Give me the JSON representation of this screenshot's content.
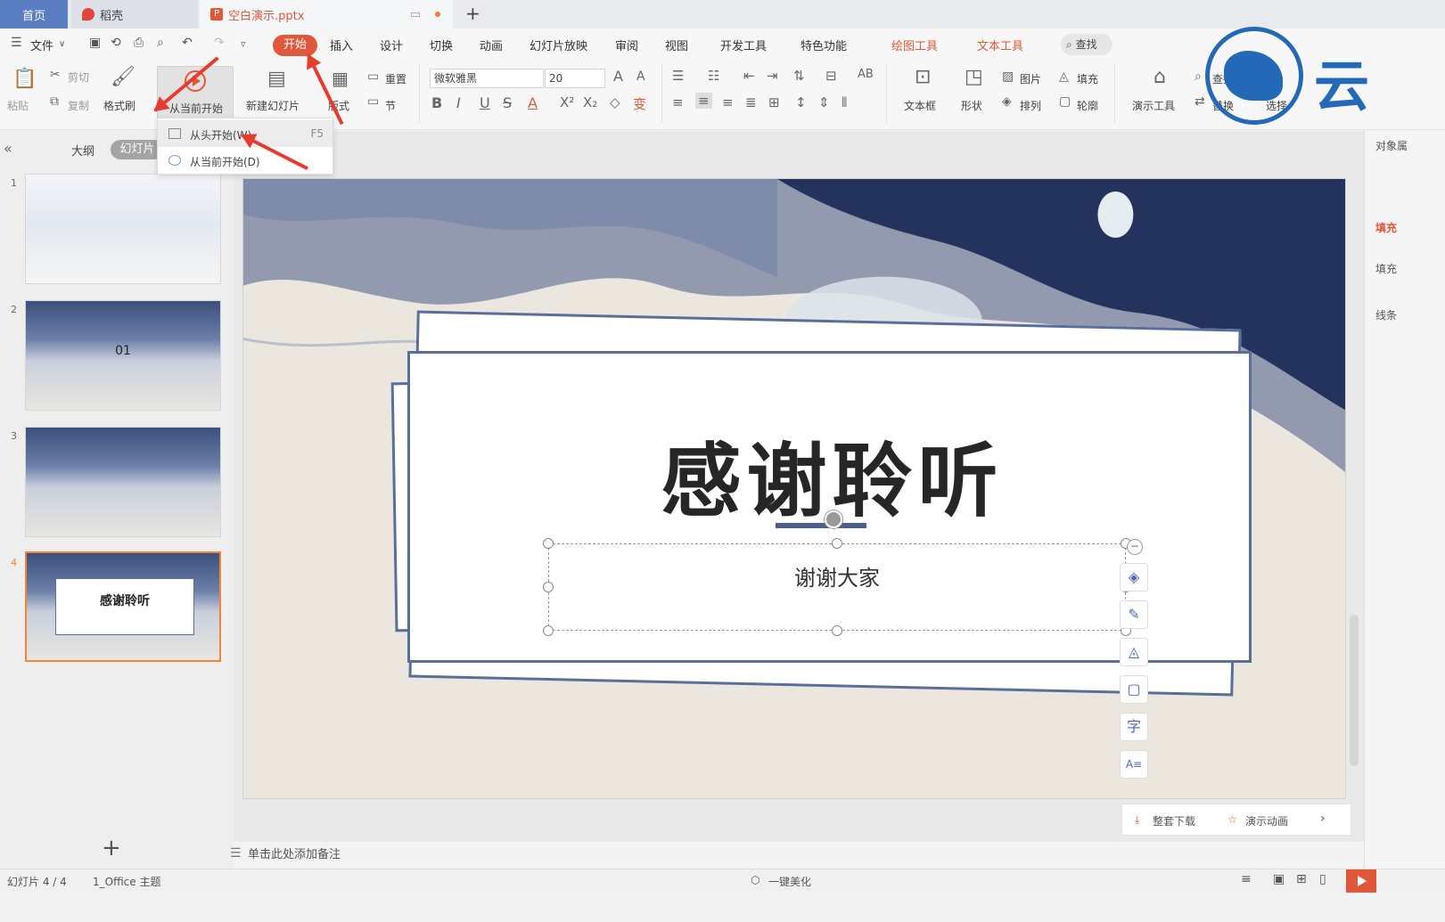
{
  "tabs": {
    "home": "首页",
    "docer": "稻壳",
    "file": "空白演示.pptx",
    "new_tab": "+"
  },
  "menu": {
    "file": "文件",
    "items": [
      "开始",
      "插入",
      "设计",
      "切换",
      "动画",
      "幻灯片放映",
      "审阅",
      "视图",
      "开发工具",
      "特色功能"
    ],
    "context_items": [
      "绘图工具",
      "文本工具"
    ],
    "search": "查找"
  },
  "ribbon": {
    "paste": "粘贴",
    "cut": "剪切",
    "copy": "复制",
    "format_painter": "格式刷",
    "start_from_current": "从当前开始",
    "new_slide": "新建幻灯片",
    "layout": "版式",
    "reset": "重置",
    "section": "节",
    "font_name": "微软雅黑",
    "font_size": "20",
    "textbox": "文本框",
    "shape": "形状",
    "picture": "图片",
    "fill": "填充",
    "arrange": "排列",
    "outline": "轮廓",
    "present_tools": "演示工具",
    "find": "查找",
    "replace": "替换",
    "select": "选择"
  },
  "dropdown": {
    "items": [
      {
        "label": "从头开始(W)",
        "shortcut": "F5"
      },
      {
        "label": "从当前开始(D)",
        "shortcut": ""
      }
    ]
  },
  "left_panel": {
    "tab_outline": "大纲",
    "tab_slides": "幻灯片",
    "slide_numbers": [
      "1",
      "2",
      "3",
      "4"
    ],
    "thumb2_number": "01",
    "thumb4_title": "感谢聆听",
    "add_slide": "+"
  },
  "slide": {
    "title": "感谢聆听",
    "subtitle": "谢谢大家"
  },
  "float_tools": {
    "text_icon": "字",
    "wrap_icon": "A≡"
  },
  "bottom_tools": {
    "download": "整套下载",
    "animation": "演示动画"
  },
  "notes": {
    "placeholder": "单击此处添加备注"
  },
  "right_panel": {
    "title": "对象属",
    "fill_tab": "填充",
    "fill": "填充",
    "line": "线条"
  },
  "status": {
    "slide_count": "幻灯片 4 / 4",
    "theme": "1_Office 主题",
    "beautify": "一键美化"
  },
  "watermark": {
    "text": "云"
  },
  "colors": {
    "accent": "#e0573a",
    "slide_border": "#5a6e9c",
    "arrow": "#e63b2e",
    "watermark": "#2468b8"
  }
}
